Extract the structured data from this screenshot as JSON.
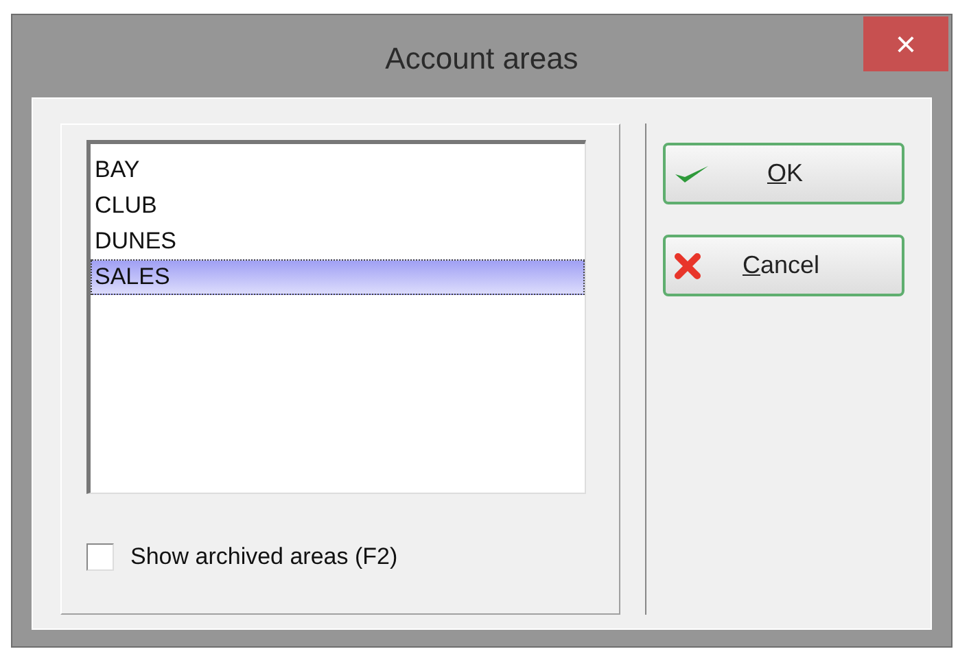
{
  "window": {
    "title": "Account areas",
    "close": "×"
  },
  "areas": [
    {
      "name": "BAY",
      "selected": false
    },
    {
      "name": "CLUB",
      "selected": false
    },
    {
      "name": "DUNES",
      "selected": false
    },
    {
      "name": "SALES",
      "selected": true
    }
  ],
  "show_archived": {
    "label": "Show archived areas (F2)",
    "checked": false
  },
  "buttons": [
    {
      "kind": "ok",
      "label": "OK"
    },
    {
      "kind": "cancel",
      "label": "Cancel"
    }
  ]
}
